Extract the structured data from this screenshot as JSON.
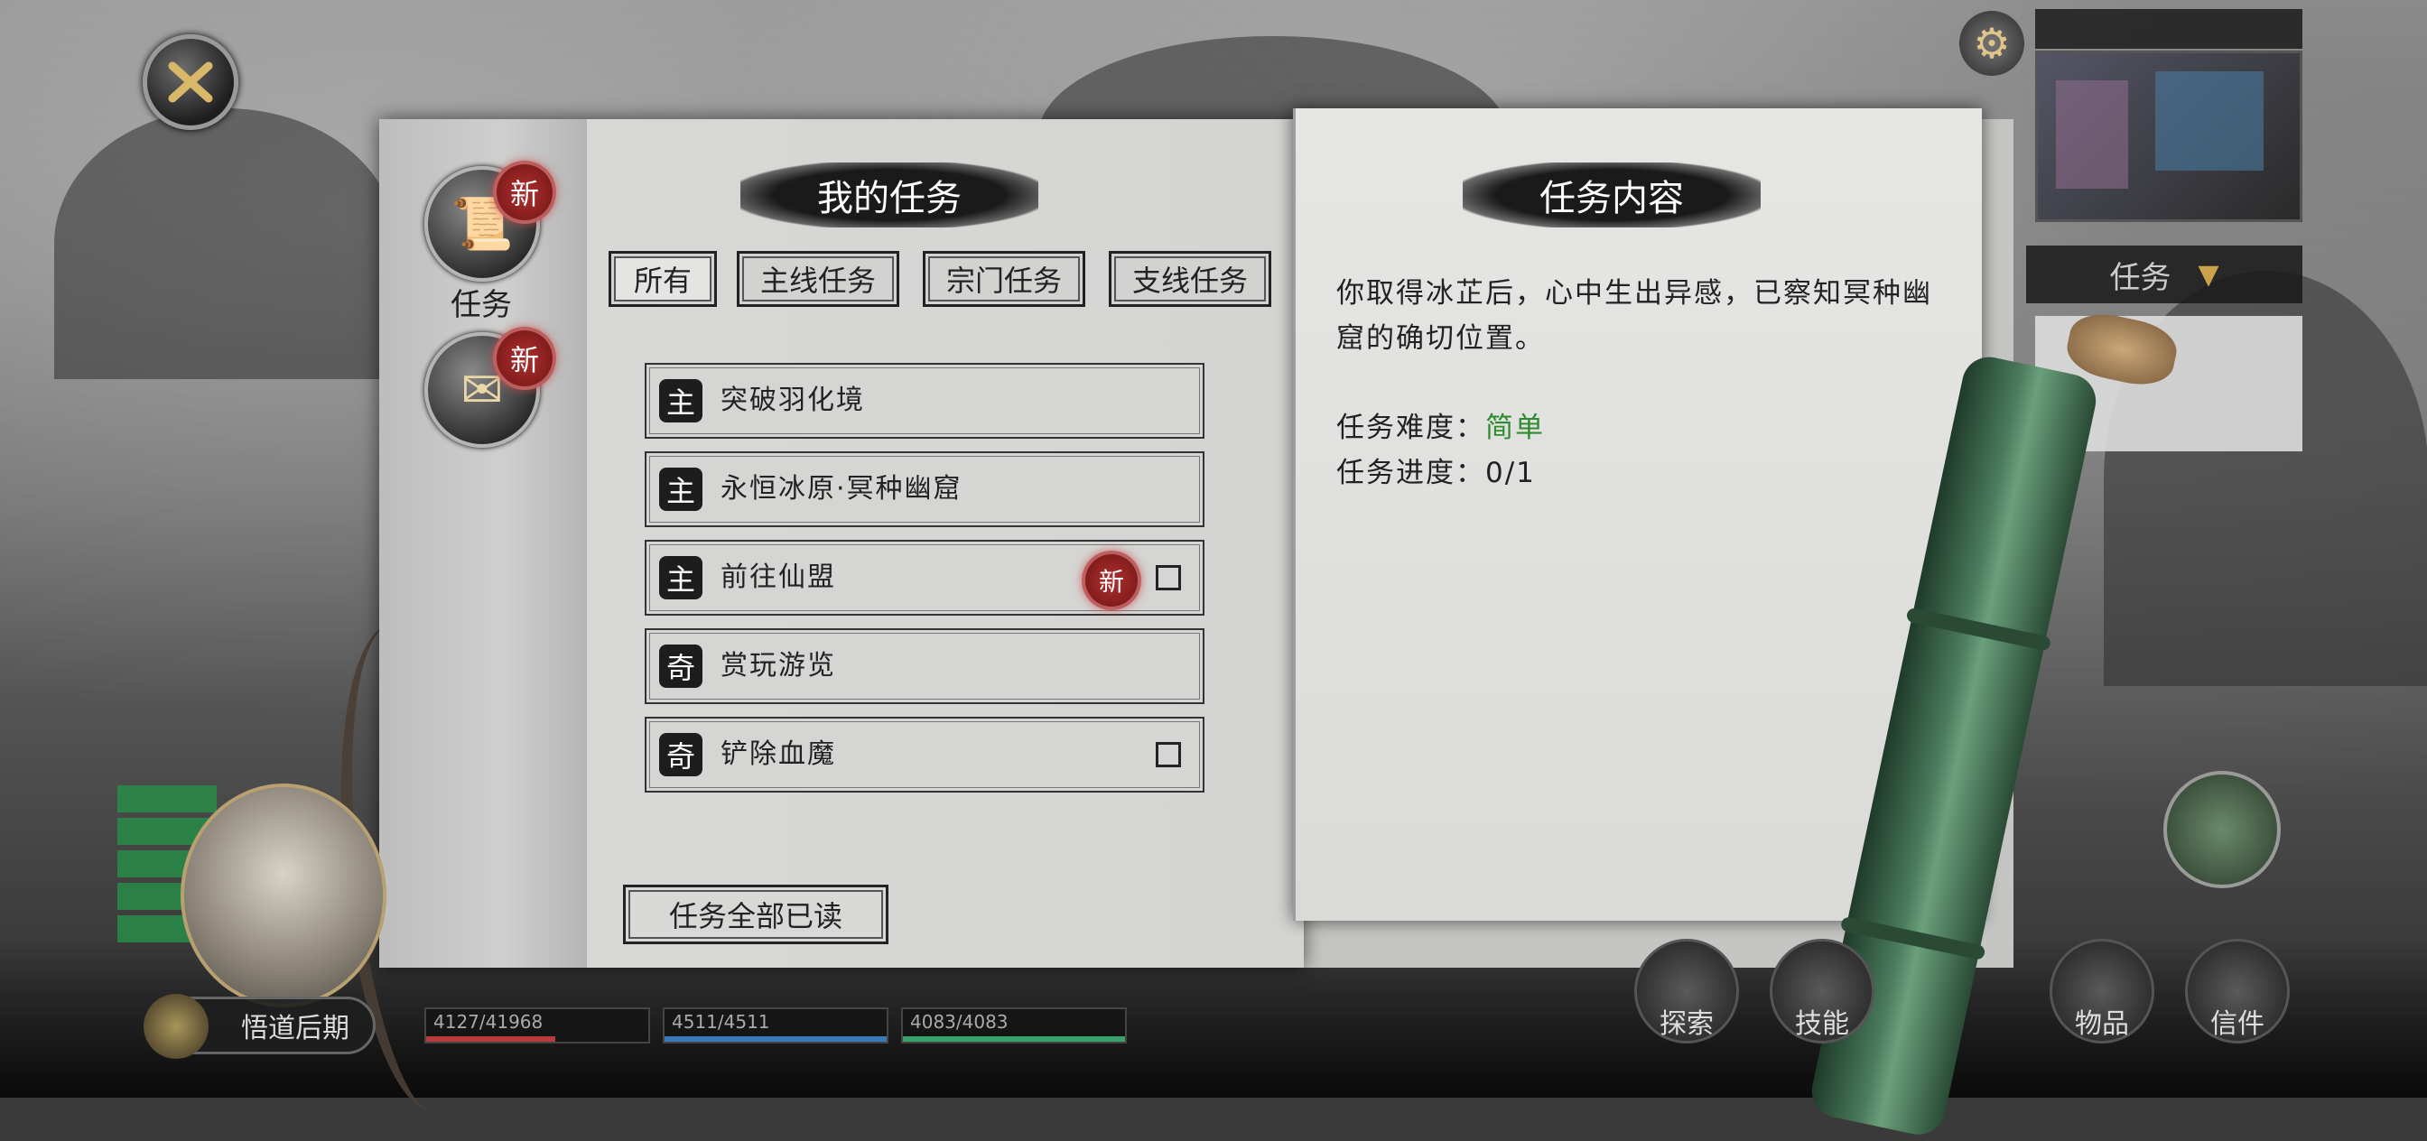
{
  "left_page": {
    "title": "我的任务",
    "side_tabs": [
      {
        "label": "任务",
        "badge": "新",
        "icon": "scroll-icon"
      },
      {
        "label": "",
        "badge": "新",
        "icon": "letter-icon"
      }
    ],
    "filters": [
      "所有",
      "主线任务",
      "宗门任务",
      "支线任务"
    ],
    "quests": [
      {
        "type": "主",
        "name": "突破羽化境",
        "is_new": false,
        "has_checkbox": false
      },
      {
        "type": "主",
        "name": "永恒冰原·冥种幽窟",
        "is_new": false,
        "has_checkbox": false
      },
      {
        "type": "主",
        "name": "前往仙盟",
        "is_new": true,
        "new_label": "新",
        "has_checkbox": true
      },
      {
        "type": "奇",
        "name": "赏玩游览",
        "is_new": false,
        "has_checkbox": false
      },
      {
        "type": "奇",
        "name": "铲除血魔",
        "is_new": false,
        "has_checkbox": true
      }
    ],
    "read_all_button": "任务全部已读"
  },
  "right_page": {
    "title": "任务内容",
    "description": "你取得冰芷后，心中生出异感，已察知冥种幽窟的确切位置。",
    "difficulty_label": "任务难度：",
    "difficulty_value": "简单",
    "progress_label": "任务进度：",
    "progress_value": "0/1"
  },
  "top_right": {
    "dropdown_label": "任务",
    "dropdown_arrow": "▼"
  },
  "hud": {
    "realm": "悟道后期",
    "stats": [
      "4127/41968",
      "4511/4511",
      "4083/4083"
    ],
    "bottom_buttons": [
      "探索",
      "技能",
      "物品",
      "信件"
    ],
    "buffs": [
      "",
      "",
      "",
      "",
      ""
    ]
  },
  "colors": {
    "difficulty_easy": "#2e8b2e",
    "new_badge": "#b13030"
  }
}
